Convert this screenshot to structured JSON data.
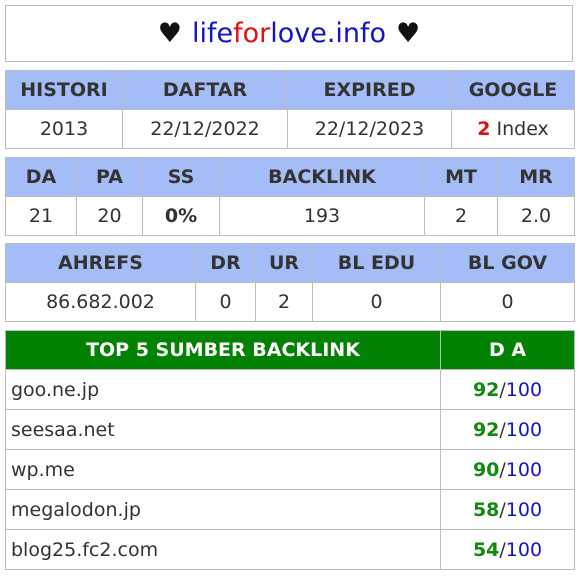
{
  "title": {
    "heart": "♥",
    "domain_part1": "life",
    "domain_part2": "for",
    "domain_part3": "love.info"
  },
  "table1": {
    "headers": [
      "HISTORI",
      "DAFTAR",
      "EXPIRED",
      "GOOGLE"
    ],
    "histori": "2013",
    "daftar": "22/12/2022",
    "expired": "22/12/2023",
    "google_count": "2",
    "google_label": "Index"
  },
  "table2": {
    "headers": [
      "DA",
      "PA",
      "SS",
      "BACKLINK",
      "MT",
      "MR"
    ],
    "values": [
      "21",
      "20",
      "0%",
      "193",
      "2",
      "2.0"
    ]
  },
  "table3": {
    "headers": [
      "AHREFS",
      "DR",
      "UR",
      "BL EDU",
      "BL GOV"
    ],
    "values": [
      "86.682.002",
      "0",
      "2",
      "0",
      "0"
    ]
  },
  "top5": {
    "header_site": "TOP 5 SUMBER BACKLINK",
    "header_da": "D A",
    "separator": "/",
    "max": "100",
    "rows": [
      {
        "site": "goo.ne.jp",
        "da": "92"
      },
      {
        "site": "seesaa.net",
        "da": "92"
      },
      {
        "site": "wp.me",
        "da": "90"
      },
      {
        "site": "megalodon.jp",
        "da": "58"
      },
      {
        "site": "blog25.fc2.com",
        "da": "54"
      }
    ]
  },
  "colors": {
    "header_blue": "#a4bdf6",
    "header_green": "#028202",
    "domain_blue": "#1515c8",
    "domain_red": "#e01010",
    "ss_green": "#7cd11c",
    "da_green": "#118a11"
  }
}
